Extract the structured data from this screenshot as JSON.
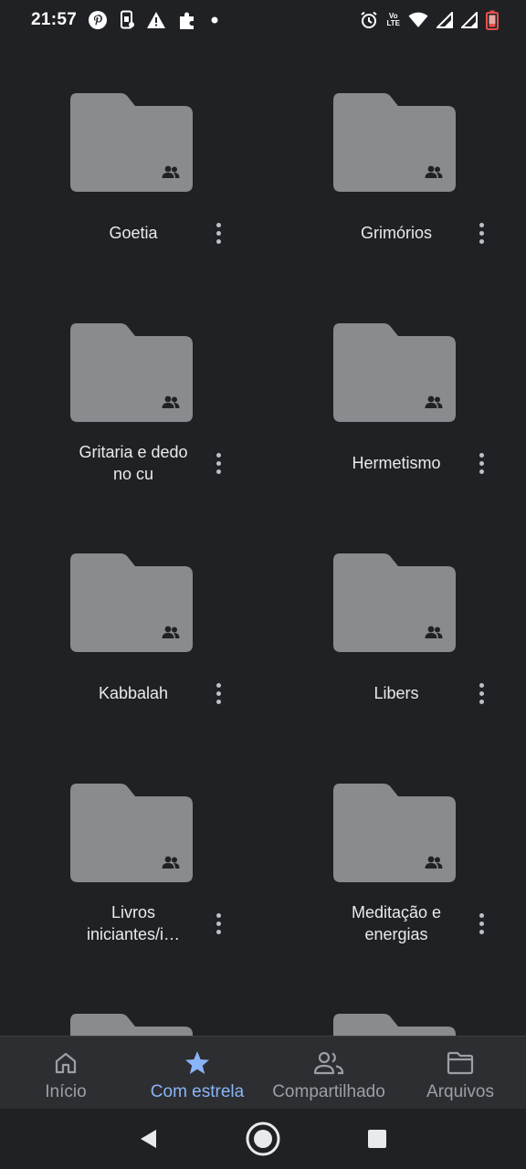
{
  "status_bar": {
    "time": "21:57",
    "left_icons": [
      "pinterest-icon",
      "phone-screen-icon",
      "warning-icon",
      "puzzle-icon",
      "dot-icon"
    ],
    "right_icons": [
      "alarm-icon",
      "volte-icon",
      "wifi-icon",
      "signal-icon",
      "signal-icon",
      "battery-low-icon"
    ],
    "volte_top": "Vo",
    "volte_bottom": "LTE"
  },
  "folders": [
    {
      "name": "Goetia",
      "shared": true
    },
    {
      "name": "Grimórios",
      "shared": true
    },
    {
      "name": "Gritaria e dedo no cu",
      "shared": true
    },
    {
      "name": "Hermetismo",
      "shared": true
    },
    {
      "name": "Kabbalah",
      "shared": true
    },
    {
      "name": "Libers",
      "shared": true
    },
    {
      "name": "Livros iniciantes/i…",
      "shared": true
    },
    {
      "name": "Meditação e energias",
      "shared": true
    }
  ],
  "bottom_nav": {
    "items": [
      {
        "label": "Início",
        "icon": "home-icon",
        "active": false
      },
      {
        "label": "Com estrela",
        "icon": "star-icon",
        "active": true
      },
      {
        "label": "Compartilhado",
        "icon": "people-icon",
        "active": false
      },
      {
        "label": "Arquivos",
        "icon": "folder-icon",
        "active": false
      }
    ]
  },
  "system_nav": [
    "back-icon",
    "home-circle-icon",
    "recents-icon"
  ],
  "colors": {
    "background": "#202124",
    "folder": "#898b8f",
    "active_accent": "#8ab4f8",
    "inactive_text": "#9aa0a6"
  }
}
